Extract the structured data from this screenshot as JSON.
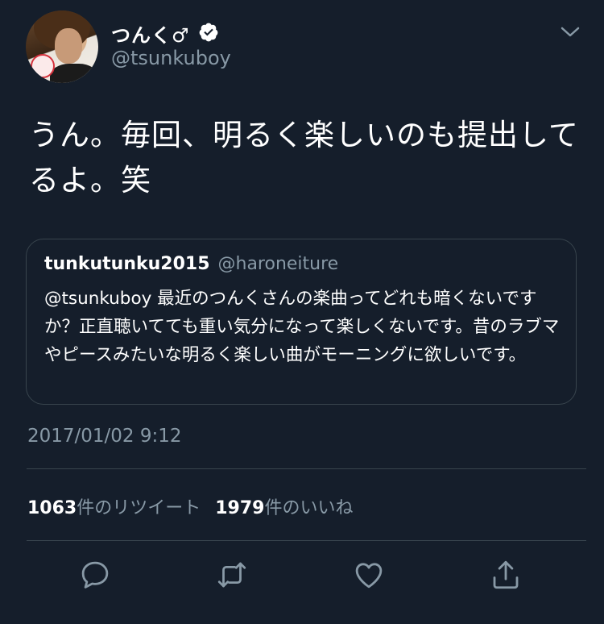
{
  "tweet": {
    "display_name": "つんく♂",
    "handle": "@tsunkuboy",
    "text": "うん。毎回、明るく楽しいのも提出してるよ。笑",
    "timestamp": "2017/01/02 9:12"
  },
  "quoted_tweet": {
    "display_name": "tunkutunku2015",
    "handle": "@haroneiture",
    "text": "@tsunkuboy 最近のつんくさんの楽曲ってどれも暗くないですか？正直聴いてても重い気分になって楽しくないです。昔のラブマやピースみたいな明るく楽しい曲がモーニングに欲しいです。"
  },
  "stats": {
    "retweets_count": "1063",
    "retweets_label": "件のリツイート",
    "likes_count": "1979",
    "likes_label": "件のいいね"
  },
  "icons": {
    "verified": "verified-badge-icon",
    "menu": "chevron-down-icon",
    "reply": "reply-icon",
    "retweet": "retweet-icon",
    "like": "heart-icon",
    "share": "share-icon"
  },
  "colors": {
    "background": "#151e2b",
    "secondary_text": "#8899a6",
    "border": "#38444d"
  }
}
